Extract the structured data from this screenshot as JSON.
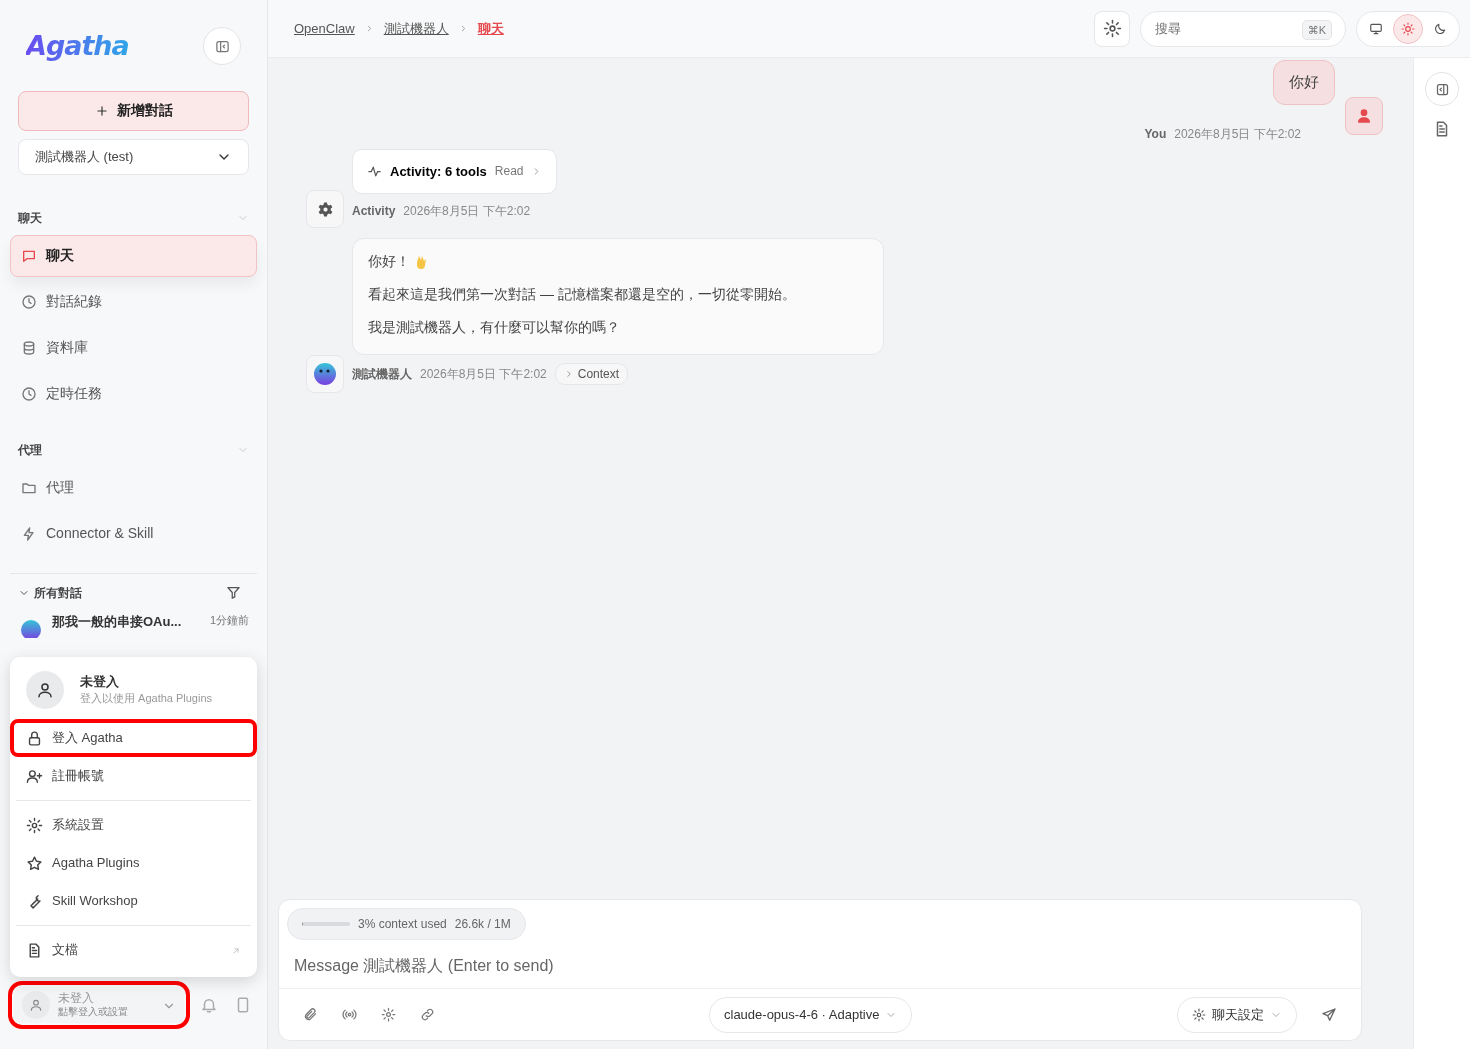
{
  "sidebar": {
    "logo": "Agatha",
    "new_chat": "新增對話",
    "agent_select": "測試機器人 (test)",
    "sections": [
      {
        "title": "聊天",
        "expanded": true,
        "items": [
          {
            "label": "聊天",
            "selected": true
          },
          {
            "label": "對話紀錄",
            "selected": false
          },
          {
            "label": "資料庫",
            "selected": false
          },
          {
            "label": "定時任務",
            "selected": false
          }
        ]
      },
      {
        "title": "代理",
        "expanded": true,
        "items": [
          {
            "label": "代理",
            "selected": false
          },
          {
            "label": "Connector & Skill",
            "selected": false
          }
        ]
      }
    ],
    "conversations": {
      "title": "所有對話",
      "expanded": true,
      "items": [
        {
          "title": "那我一般的串接OAu...",
          "time": "1分鐘前"
        }
      ]
    },
    "user": {
      "name": "未登入",
      "hint": "點擊登入或設置",
      "highlighted": true
    }
  },
  "user_menu": {
    "name": "未登入",
    "subtitle": "登入以使用 Agatha Plugins",
    "groups": [
      [
        {
          "label": "登入 Agatha",
          "highlighted": true,
          "external": false
        },
        {
          "label": "註冊帳號",
          "highlighted": false,
          "external": false
        }
      ],
      [
        {
          "label": "系統設置",
          "highlighted": false,
          "external": false
        },
        {
          "label": "Agatha Plugins",
          "highlighted": false,
          "external": false
        },
        {
          "label": "Skill Workshop",
          "highlighted": false,
          "external": false
        }
      ],
      [
        {
          "label": "文檔",
          "highlighted": false,
          "external": true
        }
      ]
    ]
  },
  "breadcrumb": [
    {
      "label": "OpenClaw",
      "current": false
    },
    {
      "label": "測試機器人",
      "current": false
    },
    {
      "label": "聊天",
      "current": true
    }
  ],
  "search": {
    "placeholder": "搜尋",
    "shortcut": "⌘K"
  },
  "theme_options": [
    {
      "kind": "system",
      "selected": false
    },
    {
      "kind": "light",
      "selected": true
    },
    {
      "kind": "dark",
      "selected": false
    }
  ],
  "messages": [
    {
      "kind": "user",
      "text": "你好",
      "sender": "You",
      "time": "2026年8月5日 下午2:02"
    },
    {
      "kind": "activity",
      "title": "Activity: 6 tools",
      "tag": "Read",
      "sender": "Activity",
      "time": "2026年8月5日 下午2:02"
    },
    {
      "kind": "assistant",
      "paragraphs": [
        "你好！",
        "看起來這是我們第一次對話 — 記憶檔案都還是空的，一切從零開始。",
        "我是測試機器人，有什麼可以幫你的嗎？"
      ],
      "sender": "測試機器人",
      "time": "2026年8月5日 下午2:02",
      "context": "Context"
    }
  ],
  "composer": {
    "context_label": "3% context used",
    "tokens": "26.6k / 1M",
    "level": 0.03,
    "placeholder": "Message 測試機器人 (Enter to send)",
    "model": "claude-opus-4-6 · Adaptive",
    "settings": "聊天設定"
  }
}
